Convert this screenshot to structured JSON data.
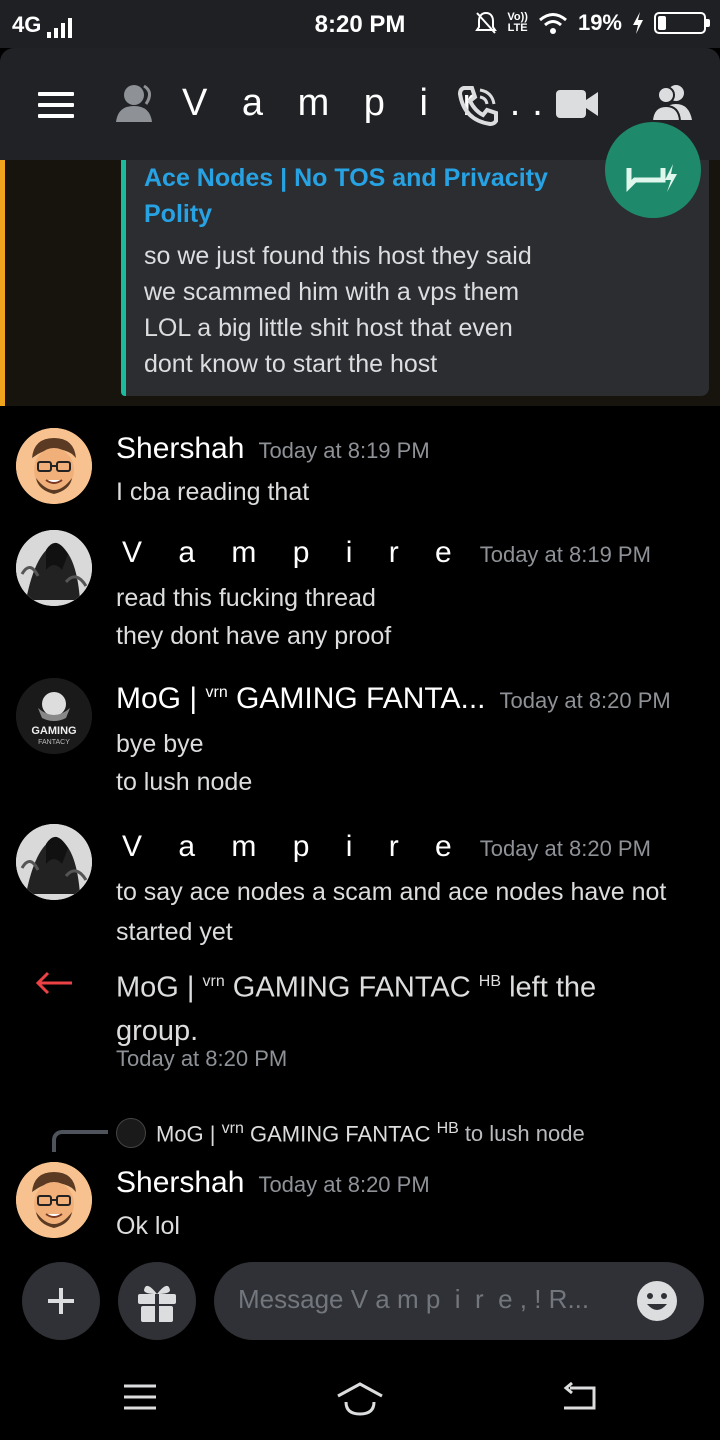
{
  "status_bar": {
    "network": "4G",
    "time": "8:20 PM",
    "volte_top": "Vo))",
    "volte_bottom": "LTE",
    "battery": "19%",
    "battery_level": 0.19
  },
  "header": {
    "title": "V a m p  i  r ..."
  },
  "embed": {
    "title": "Ace Nodes | No TOS and Privacity Polity",
    "description": "so we just found this host they said we scammed him with a vps them LOL a big little shit host that even dont know to start the host"
  },
  "messages": [
    {
      "author": "Shershah",
      "timestamp": "Today at 8:19 PM",
      "lines": [
        "I cba reading that"
      ]
    },
    {
      "author": "V a m p  i  r  e",
      "timestamp": "Today at 8:19 PM",
      "lines": [
        "read this fucking thread",
        "they dont have any proof"
      ]
    },
    {
      "author_prefix": "MoG | ",
      "author_sup": "vrn",
      "author_rest": " GAMING FANTA...",
      "timestamp": "Today at 8:20 PM",
      "lines": [
        "bye bye",
        "to lush node"
      ]
    },
    {
      "author": "V a m p  i  r  e",
      "timestamp": "Today at 8:20 PM",
      "lines": [
        "to say ace nodes a scam and ace nodes have not",
        "started yet"
      ]
    },
    {
      "author": "Shershah",
      "timestamp": "Today at 8:20 PM",
      "lines": [
        "Ok lol"
      ]
    }
  ],
  "avatar_text": {
    "mog_line1": "GAMING",
    "mog_line2": "FANTACY"
  },
  "system_message": {
    "prefix": "MoG | ",
    "sup": "vrn",
    "name": " GAMING FANTAC ",
    "sup2": "HB",
    "action": " left the group.",
    "timestamp": "Today at 8:20 PM"
  },
  "reply_reference": {
    "prefix": "MoG | ",
    "sup": "vrn",
    "name": " GAMING FANTAC ",
    "sup2": "HB",
    "message": "to lush node"
  },
  "composer": {
    "placeholder": "Message V a m p  i  r  e , ! R..."
  },
  "icons": {
    "menu": "hamburger-icon",
    "user": "user-icon",
    "call": "phone-call-icon",
    "video": "video-camera-icon",
    "members": "members-icon",
    "add": "plus-icon",
    "gift": "gift-icon",
    "emoji": "emoji-icon",
    "left": "arrow-left-icon"
  },
  "colors": {
    "accent_orange": "#f0a31c",
    "embed_bar": "#1abc9c",
    "link_blue": "#27a2e2",
    "leave_red": "#ed4245"
  }
}
